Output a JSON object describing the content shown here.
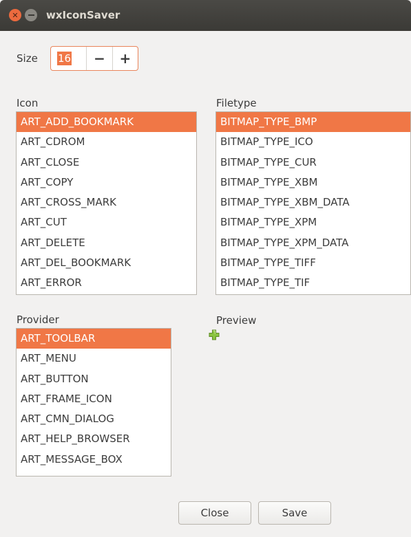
{
  "window": {
    "title": "wxIconSaver"
  },
  "size": {
    "label": "Size",
    "value": "16",
    "minus": "−",
    "plus": "+"
  },
  "icon": {
    "label": "Icon",
    "items": [
      "ART_ADD_BOOKMARK",
      "ART_CDROM",
      "ART_CLOSE",
      "ART_COPY",
      "ART_CROSS_MARK",
      "ART_CUT",
      "ART_DELETE",
      "ART_DEL_BOOKMARK",
      "ART_ERROR"
    ],
    "selected": 0
  },
  "filetype": {
    "label": "Filetype",
    "items": [
      "BITMAP_TYPE_BMP",
      "BITMAP_TYPE_ICO",
      "BITMAP_TYPE_CUR",
      "BITMAP_TYPE_XBM",
      "BITMAP_TYPE_XBM_DATA",
      "BITMAP_TYPE_XPM",
      "BITMAP_TYPE_XPM_DATA",
      "BITMAP_TYPE_TIFF",
      "BITMAP_TYPE_TIF"
    ],
    "selected": 0
  },
  "provider": {
    "label": "Provider",
    "items": [
      "ART_TOOLBAR",
      "ART_MENU",
      "ART_BUTTON",
      "ART_FRAME_ICON",
      "ART_CMN_DIALOG",
      "ART_HELP_BROWSER",
      "ART_MESSAGE_BOX"
    ],
    "selected": 0
  },
  "preview": {
    "label": "Preview",
    "icon": "add-bookmark-plus-icon",
    "icon_color": "#8ac43f"
  },
  "buttons": {
    "close": "Close",
    "save": "Save"
  },
  "colors": {
    "accent": "#f07746",
    "titlebar": "#3b3a36"
  }
}
